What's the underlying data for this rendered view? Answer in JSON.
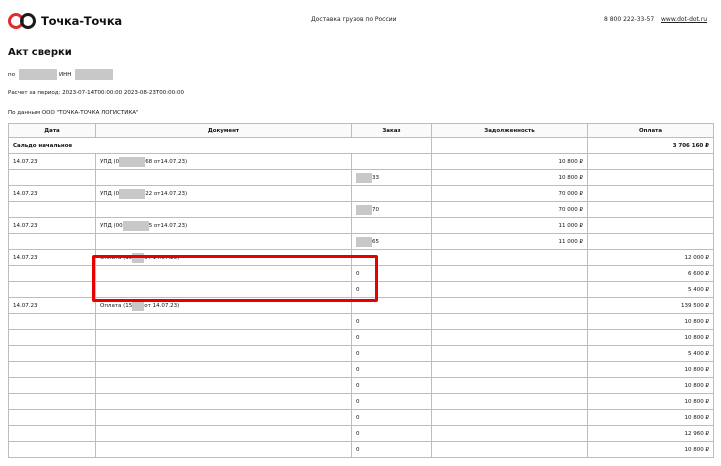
{
  "header": {
    "brand": "Точка-Точка",
    "tagline": "Доставка грузов по России",
    "phone": "8 800 222-33-57",
    "site": "www.dot-dot.ru"
  },
  "title": "Акт сверки",
  "po_label": "по",
  "inn_label": "ИНН",
  "period": "Расчет за период: 2023-07-14T00:00:00 2023-08-23T00:00:00",
  "source": "По данным ООО \"ТОЧКА-ТОЧКА ЛОГИСТИКА\"",
  "table": {
    "headers": {
      "date": "Дата",
      "document": "Документ",
      "order": "Заказ",
      "debt": "Задолженность",
      "payment": "Оплата"
    },
    "opening": {
      "label": "Сальдо начальное",
      "payment": "3 706 160 ₽"
    },
    "rows": [
      {
        "date": "14.07.23",
        "doc_a": "УПД (0",
        "doc_b": "68 от14.07.23)",
        "order_a": "",
        "order_b": "",
        "debt": "10 800 ₽",
        "payment": ""
      },
      {
        "date": "",
        "doc_a": "",
        "doc_b": "",
        "order_a": "",
        "order_b": "33",
        "debt": "10 800 ₽",
        "payment": ""
      },
      {
        "date": "14.07.23",
        "doc_a": "УПД (0",
        "doc_b": "22 от14.07.23)",
        "order_a": "",
        "order_b": "",
        "debt": "70 000 ₽",
        "payment": ""
      },
      {
        "date": "",
        "doc_a": "",
        "doc_b": "",
        "order_a": "",
        "order_b": "70",
        "debt": "70 000 ₽",
        "payment": ""
      },
      {
        "date": "14.07.23",
        "doc_a": "УПД (00",
        "doc_b": "5 от14.07.23)",
        "order_a": "",
        "order_b": "",
        "debt": "11 000 ₽",
        "payment": ""
      },
      {
        "date": "",
        "doc_a": "",
        "doc_b": "",
        "order_a": "",
        "order_b": "65",
        "debt": "11 000 ₽",
        "payment": ""
      },
      {
        "date": "14.07.23",
        "doc_a": "Оплата (15",
        "doc_b": "от 14.07.23)",
        "order_a": "",
        "order_b": "",
        "debt": "",
        "payment": "12 000 ₽"
      },
      {
        "date": "",
        "doc_a": "",
        "doc_b": "",
        "order_a": "0",
        "order_b": "",
        "debt": "",
        "payment": "6 600 ₽"
      },
      {
        "date": "",
        "doc_a": "",
        "doc_b": "",
        "order_a": "0",
        "order_b": "",
        "debt": "",
        "payment": "5 400 ₽"
      },
      {
        "date": "14.07.23",
        "doc_a": "Оплата (15",
        "doc_b": "от 14.07.23)",
        "order_a": "",
        "order_b": "",
        "debt": "",
        "payment": "139 500 ₽"
      },
      {
        "date": "",
        "doc_a": "",
        "doc_b": "",
        "order_a": "0",
        "order_b": "",
        "debt": "",
        "payment": "10 800 ₽"
      },
      {
        "date": "",
        "doc_a": "",
        "doc_b": "",
        "order_a": "0",
        "order_b": "",
        "debt": "",
        "payment": "10 800 ₽"
      },
      {
        "date": "",
        "doc_a": "",
        "doc_b": "",
        "order_a": "0",
        "order_b": "",
        "debt": "",
        "payment": "5 400 ₽"
      },
      {
        "date": "",
        "doc_a": "",
        "doc_b": "",
        "order_a": "0",
        "order_b": "",
        "debt": "",
        "payment": "10 800 ₽"
      },
      {
        "date": "",
        "doc_a": "",
        "doc_b": "",
        "order_a": "0",
        "order_b": "",
        "debt": "",
        "payment": "10 800 ₽"
      },
      {
        "date": "",
        "doc_a": "",
        "doc_b": "",
        "order_a": "0",
        "order_b": "",
        "debt": "",
        "payment": "10 800 ₽"
      },
      {
        "date": "",
        "doc_a": "",
        "doc_b": "",
        "order_a": "0",
        "order_b": "",
        "debt": "",
        "payment": "10 800 ₽"
      },
      {
        "date": "",
        "doc_a": "",
        "doc_b": "",
        "order_a": "0",
        "order_b": "",
        "debt": "",
        "payment": "12 960 ₽"
      },
      {
        "date": "",
        "doc_a": "",
        "doc_b": "",
        "order_a": "0",
        "order_b": "",
        "debt": "",
        "payment": "10 800 ₽"
      }
    ]
  }
}
